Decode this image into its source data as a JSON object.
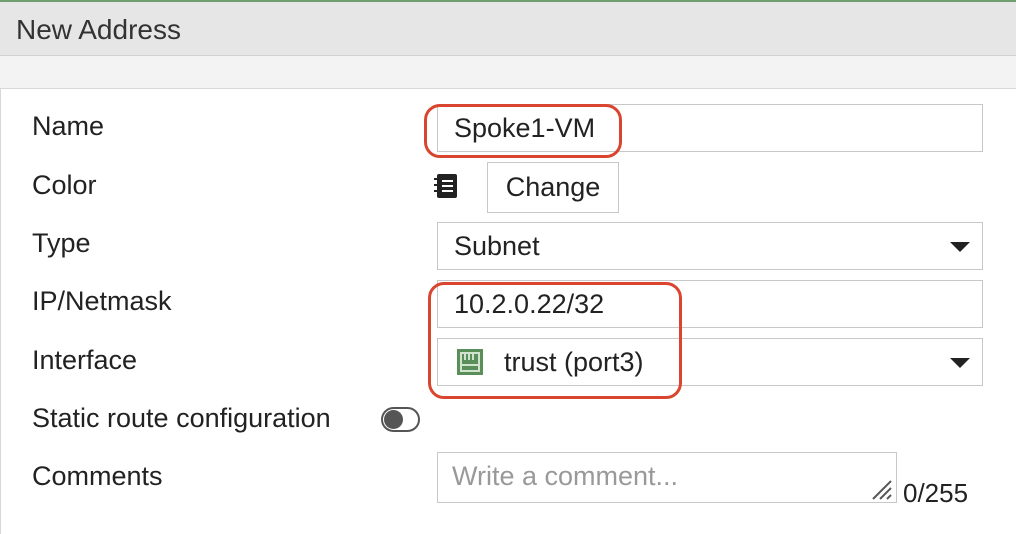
{
  "dialog": {
    "title": "New Address"
  },
  "form": {
    "name": {
      "label": "Name",
      "value": "Spoke1-VM"
    },
    "color": {
      "label": "Color",
      "icon": "color-swatch-icon",
      "button_label": "Change"
    },
    "type": {
      "label": "Type",
      "value": "Subnet"
    },
    "ip_netmask": {
      "label": "IP/Netmask",
      "value": "10.2.0.22/32"
    },
    "interface": {
      "label": "Interface",
      "value": "trust (port3)",
      "icon": "network-port-icon"
    },
    "static_route": {
      "label": "Static route configuration",
      "enabled": false
    },
    "comments": {
      "label": "Comments",
      "placeholder": "Write a comment...",
      "counter": "0/255"
    }
  },
  "colors": {
    "highlight": "#d9452f",
    "title_bar_bg": "#e6e6e6",
    "port_icon": "#5a8f5a"
  }
}
